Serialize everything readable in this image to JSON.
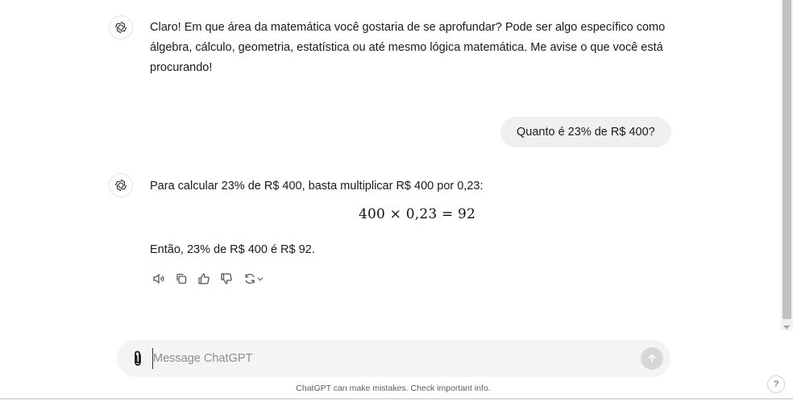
{
  "messages": {
    "assistant_1": {
      "text": "Claro! Em que área da matemática você gostaria de se aprofundar? Pode ser algo específico como álgebra, cálculo, geometria, estatística ou até mesmo lógica matemática. Me avise o que você está procurando!"
    },
    "user_1": {
      "text": "Quanto é 23% de R$ 400?"
    },
    "assistant_2": {
      "intro": "Para calcular 23% de R$ 400, basta multiplicar R$ 400 por 0,23:",
      "math": "400 × 0,23 = 92",
      "conclusion": "Então, 23% de R$ 400 é R$ 92."
    }
  },
  "actions": [
    "read-aloud-icon",
    "copy-icon",
    "thumbs-up-icon",
    "thumbs-down-icon",
    "regenerate-icon"
  ],
  "composer": {
    "placeholder": "Message ChatGPT"
  },
  "footer": {
    "disclaimer": "ChatGPT can make mistakes. Check important info."
  },
  "help": {
    "label": "?"
  }
}
